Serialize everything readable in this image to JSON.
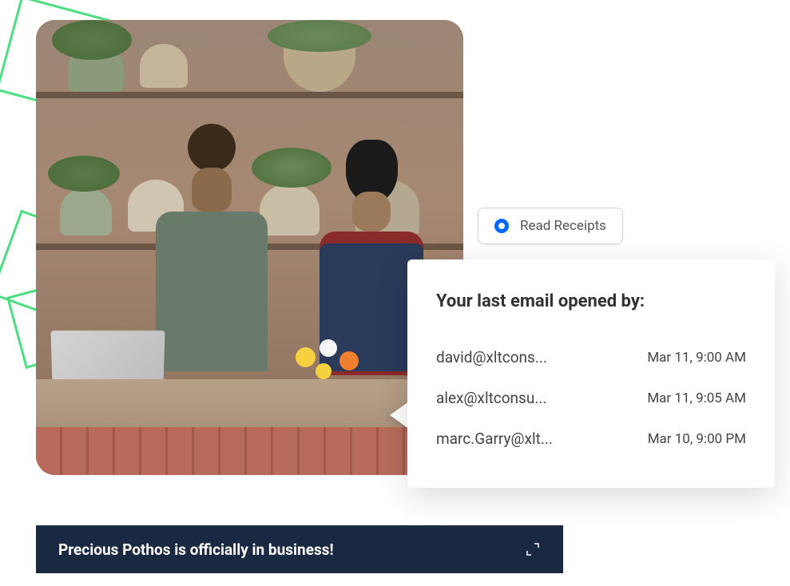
{
  "badge": {
    "label": "Read Receipts"
  },
  "email_card": {
    "title": "Your last email opened by:",
    "rows": [
      {
        "email": "david@xltcons...",
        "timestamp": "Mar 11, 9:00 AM"
      },
      {
        "email": "alex@xltconsu...",
        "timestamp": "Mar 11, 9:05 AM"
      },
      {
        "email": "marc.Garry@xlt...",
        "timestamp": "Mar 10, 9:00 PM"
      }
    ]
  },
  "banner": {
    "text": "Precious Pothos is officially in business!"
  },
  "colors": {
    "accent_green": "#4ade80",
    "accent_blue": "#0066ff",
    "banner_bg": "#1a2942"
  }
}
